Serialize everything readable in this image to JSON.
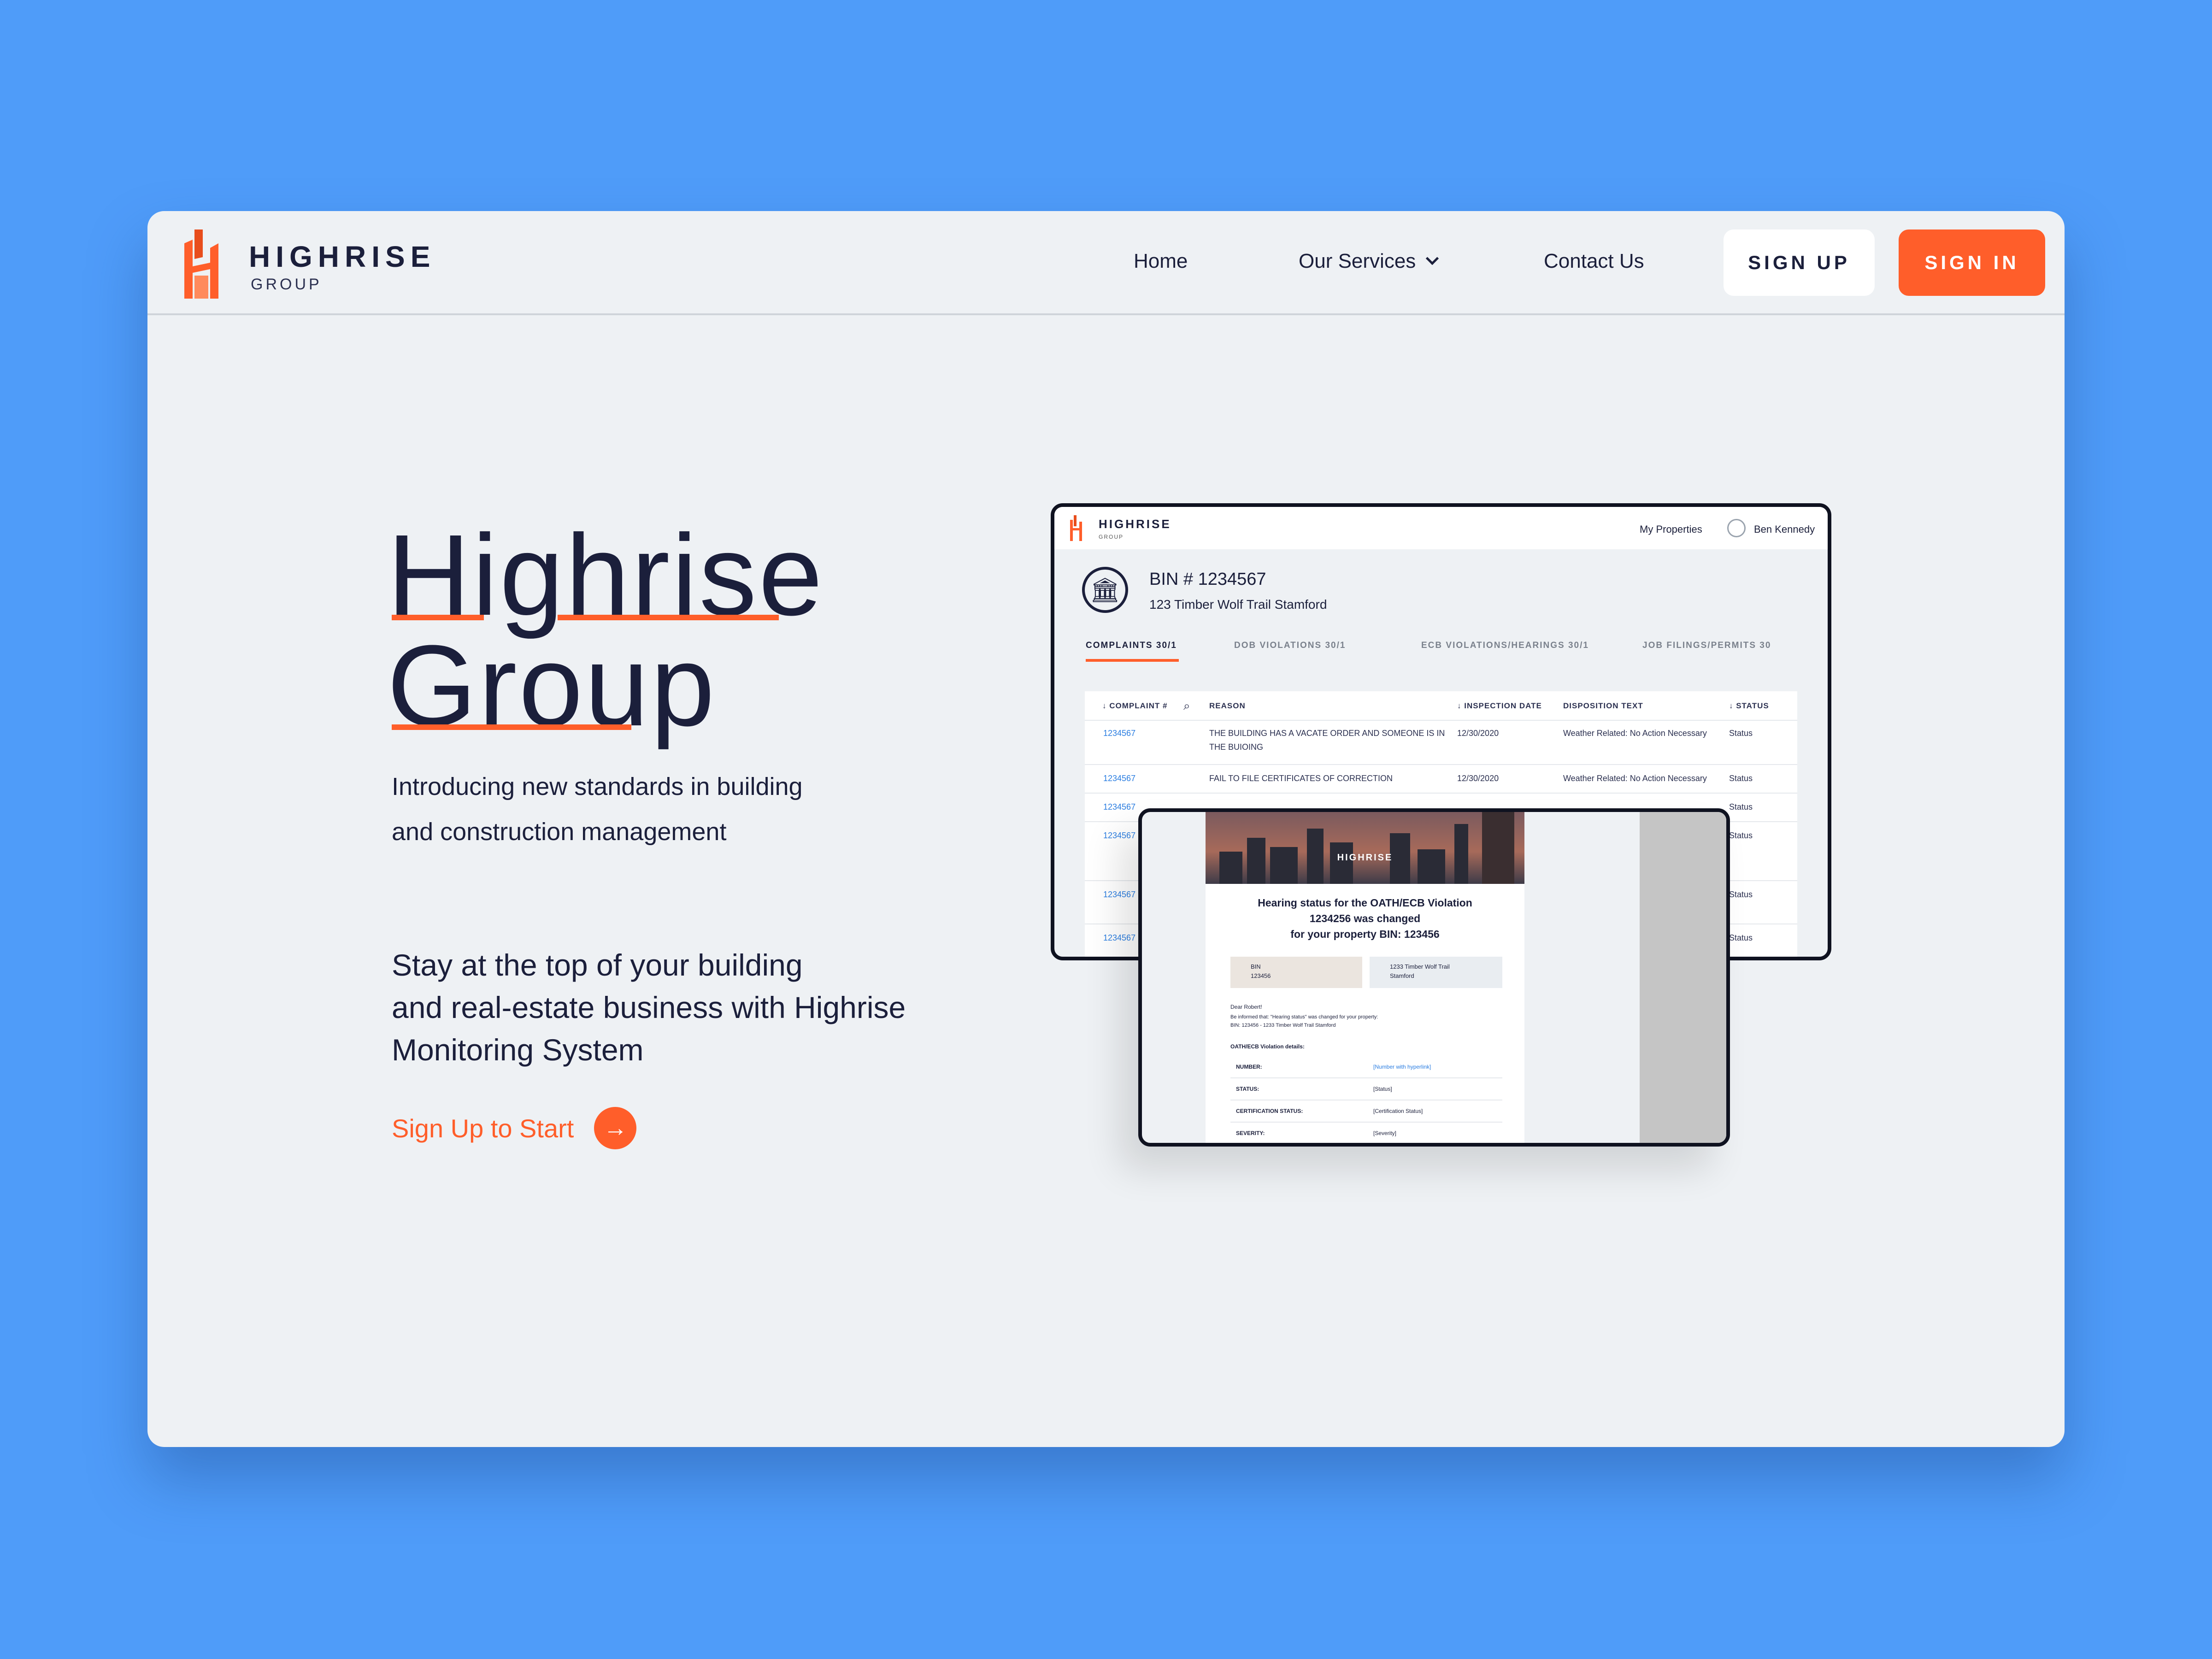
{
  "nav": {
    "brand_name": "HIGHRISE",
    "brand_sub": "GROUP",
    "home": "Home",
    "services": "Our Services",
    "contact": "Contact Us",
    "signup": "SIGN UP",
    "signin": "SIGN IN"
  },
  "hero": {
    "title_line1": "Highrise",
    "title_line2": "Group",
    "subtitle_line1": "Introducing new standards in building",
    "subtitle_line2": "and construction management",
    "tagline_line1": "Stay at the top of your building",
    "tagline_line2": "and real-estate business with Highrise",
    "tagline_line3": "Monitoring System",
    "cta": "Sign Up to Start"
  },
  "dashboard": {
    "brand": "HIGHRISE",
    "brand_sub": "GROUP",
    "my_properties": "My Properties",
    "user": "Ben Kennedy",
    "bin": "BIN # 1234567",
    "address": "123 Timber Wolf Trail Stamford",
    "tabs": [
      "COMPLAINTS 30/1",
      "DOB VIOLATIONS 30/1",
      "ECB VIOLATIONS/HEARINGS 30/1",
      "JOB FILINGS/PERMITS 30"
    ],
    "columns": [
      "↓ COMPLAINT #",
      "REASON",
      "↓ INSPECTION DATE",
      "DISPOSITION TEXT",
      "↓ STATUS"
    ],
    "rows": [
      {
        "id": "1234567",
        "reason": "THE BUILDING HAS A VACATE ORDER AND SOMEONE IS IN THE BUIOING",
        "date": "12/30/2020",
        "disposition": "Weather Related: No Action Necessary",
        "status": "Status"
      },
      {
        "id": "1234567",
        "reason": "FAIL TO FILE CERTIFICATES OF CORRECTION",
        "date": "12/30/2020",
        "disposition": "Weather Related: No Action Necessary",
        "status": "Status"
      },
      {
        "id": "1234567",
        "reason": "",
        "date": "",
        "disposition": "",
        "status": "Status"
      },
      {
        "id": "1234567",
        "reason": "",
        "date": "",
        "disposition": "",
        "status": "Status"
      },
      {
        "id": "1234567",
        "reason": "",
        "date": "",
        "disposition": "",
        "status": "Status"
      },
      {
        "id": "1234567",
        "reason": "",
        "date": "",
        "disposition": "",
        "status": "Status"
      }
    ]
  },
  "email": {
    "banner_brand": "HIGHRISE",
    "heading_line1": "Hearing status for the OATH/ECB Violation",
    "heading_line2": "1234256 was changed",
    "heading_line3": "for your property BIN: 123456",
    "bin_label": "BIN",
    "bin_value": "123456",
    "address_line1": "1233 Timber Wolf Trail",
    "address_line2": "Stamford",
    "greeting": "Dear Robert!",
    "body_line1": "Be informed that: \"Hearing status\" was changed for your property:",
    "body_line2": "BIN: 123456 - 1233 Timber Wolf Trail Stamford",
    "details_title": "OATH/ECB Violation details:",
    "details": [
      {
        "label": "NUMBER:",
        "value": "[Number with hyperlink]"
      },
      {
        "label": "STATUS:",
        "value": "[Status]"
      },
      {
        "label": "CERTIFICATION STATUS:",
        "value": "[Certification Status]"
      },
      {
        "label": "SEVERITY:",
        "value": "[Severity]"
      }
    ]
  },
  "colors": {
    "background": "#4f9cf9",
    "accent": "#ff5e2a",
    "ink": "#1b1f3b",
    "card": "#eef1f4",
    "link": "#2a7de1"
  }
}
